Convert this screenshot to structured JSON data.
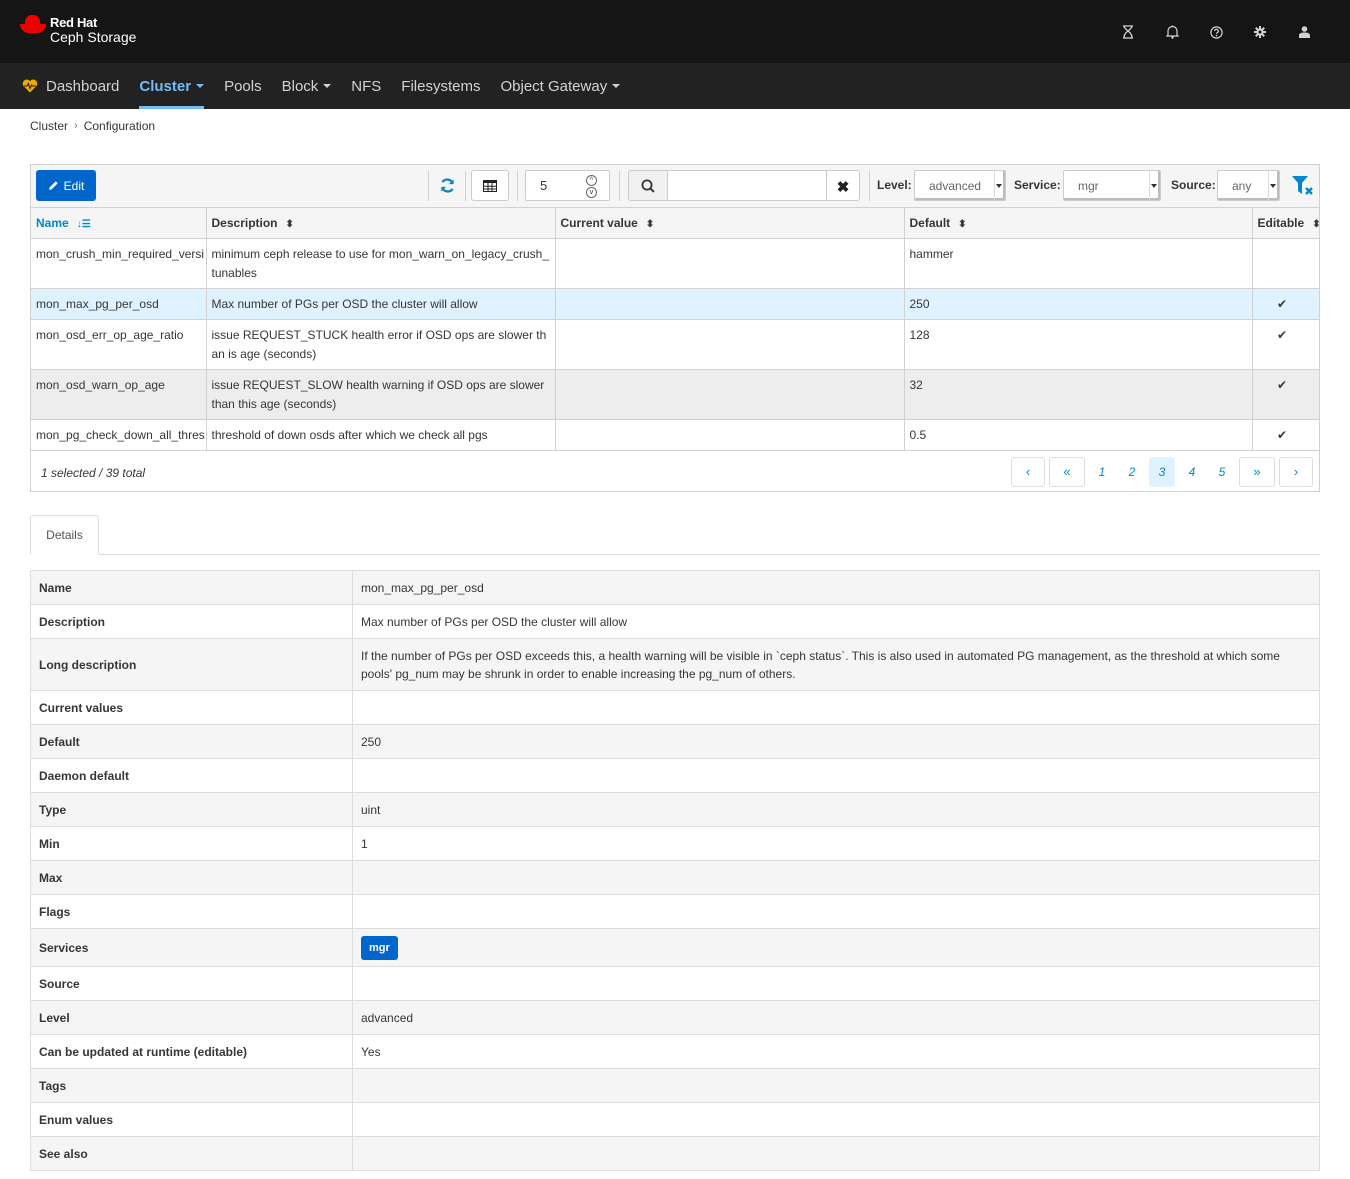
{
  "brand": {
    "line1": "Red Hat",
    "line2": "Ceph Storage"
  },
  "top_icons": [
    {
      "name": "hourglass-icon",
      "label": "Running tasks"
    },
    {
      "name": "bell-icon",
      "label": "Notifications"
    },
    {
      "name": "help-icon",
      "label": "Help"
    },
    {
      "name": "gear-icon",
      "label": "Settings"
    },
    {
      "name": "user-icon",
      "label": "User"
    }
  ],
  "nav": {
    "items": [
      {
        "label": "Dashboard",
        "dropdown": false,
        "active": false
      },
      {
        "label": "Cluster",
        "dropdown": true,
        "active": true
      },
      {
        "label": "Pools",
        "dropdown": false,
        "active": false
      },
      {
        "label": "Block",
        "dropdown": true,
        "active": false
      },
      {
        "label": "NFS",
        "dropdown": false,
        "active": false
      },
      {
        "label": "Filesystems",
        "dropdown": false,
        "active": false
      },
      {
        "label": "Object Gateway",
        "dropdown": true,
        "active": false
      }
    ]
  },
  "breadcrumb": {
    "items": [
      "Cluster",
      "Configuration"
    ],
    "separator": "›"
  },
  "toolbar": {
    "edit_label": "Edit",
    "page_size": "5",
    "search_value": "",
    "search_placeholder": "",
    "filters": {
      "level_label": "Level:",
      "level_value": "advanced",
      "service_label": "Service:",
      "service_value": "mgr",
      "source_label": "Source:",
      "source_value": "any"
    }
  },
  "table": {
    "columns": [
      "Name",
      "Description",
      "Current value",
      "Default",
      "Editable"
    ],
    "sorted_column": "Name",
    "rows": [
      {
        "name": "mon_crush_min_required_versi",
        "description": "minimum ceph release to use for mon_warn_on_legacy_crush_tunables",
        "current": "",
        "default": "hammer",
        "editable": ""
      },
      {
        "name": "mon_max_pg_per_osd",
        "description": "Max number of PGs per OSD the cluster will allow",
        "current": "",
        "default": "250",
        "editable": "✔"
      },
      {
        "name": "mon_osd_err_op_age_ratio",
        "description": "issue REQUEST_STUCK health error if OSD ops are slower than is age (seconds)",
        "current": "",
        "default": "128",
        "editable": "✔"
      },
      {
        "name": "mon_osd_warn_op_age",
        "description": "issue REQUEST_SLOW health warning if OSD ops are slower than this age (seconds)",
        "current": "",
        "default": "32",
        "editable": "✔"
      },
      {
        "name": "mon_pg_check_down_all_thres",
        "description": "threshold of down osds after which we check all pgs",
        "current": "",
        "default": "0.5",
        "editable": "✔"
      }
    ],
    "selection_summary": "1 selected / 39 total",
    "pagination": {
      "prev": "‹",
      "first": "«",
      "pages": [
        "1",
        "2",
        "3",
        "4",
        "5"
      ],
      "current": "3",
      "last": "»",
      "next": "›"
    }
  },
  "details_tab": "Details",
  "details": [
    {
      "key": "Name",
      "value": "mon_max_pg_per_osd"
    },
    {
      "key": "Description",
      "value": "Max number of PGs per OSD the cluster will allow"
    },
    {
      "key": "Long description",
      "value": "If the number of PGs per OSD exceeds this, a health warning will be visible in `ceph status`. This is also used in automated PG management, as the threshold at which some pools' pg_num may be shrunk in order to enable increasing the pg_num of others."
    },
    {
      "key": "Current values",
      "value": ""
    },
    {
      "key": "Default",
      "value": "250"
    },
    {
      "key": "Daemon default",
      "value": ""
    },
    {
      "key": "Type",
      "value": "uint"
    },
    {
      "key": "Min",
      "value": "1"
    },
    {
      "key": "Max",
      "value": ""
    },
    {
      "key": "Flags",
      "value": ""
    },
    {
      "key": "Services",
      "value": "mgr"
    },
    {
      "key": "Source",
      "value": ""
    },
    {
      "key": "Level",
      "value": "advanced"
    },
    {
      "key": "Can be updated at runtime (editable)",
      "value": "Yes"
    },
    {
      "key": "Tags",
      "value": ""
    },
    {
      "key": "Enum values",
      "value": ""
    },
    {
      "key": "See also",
      "value": ""
    }
  ],
  "colors": {
    "accent": "#0066cc",
    "link": "#0088ce",
    "nav_active": "#73bcf7",
    "selected_row": "#def3ff",
    "brand_red": "#ee0000"
  }
}
